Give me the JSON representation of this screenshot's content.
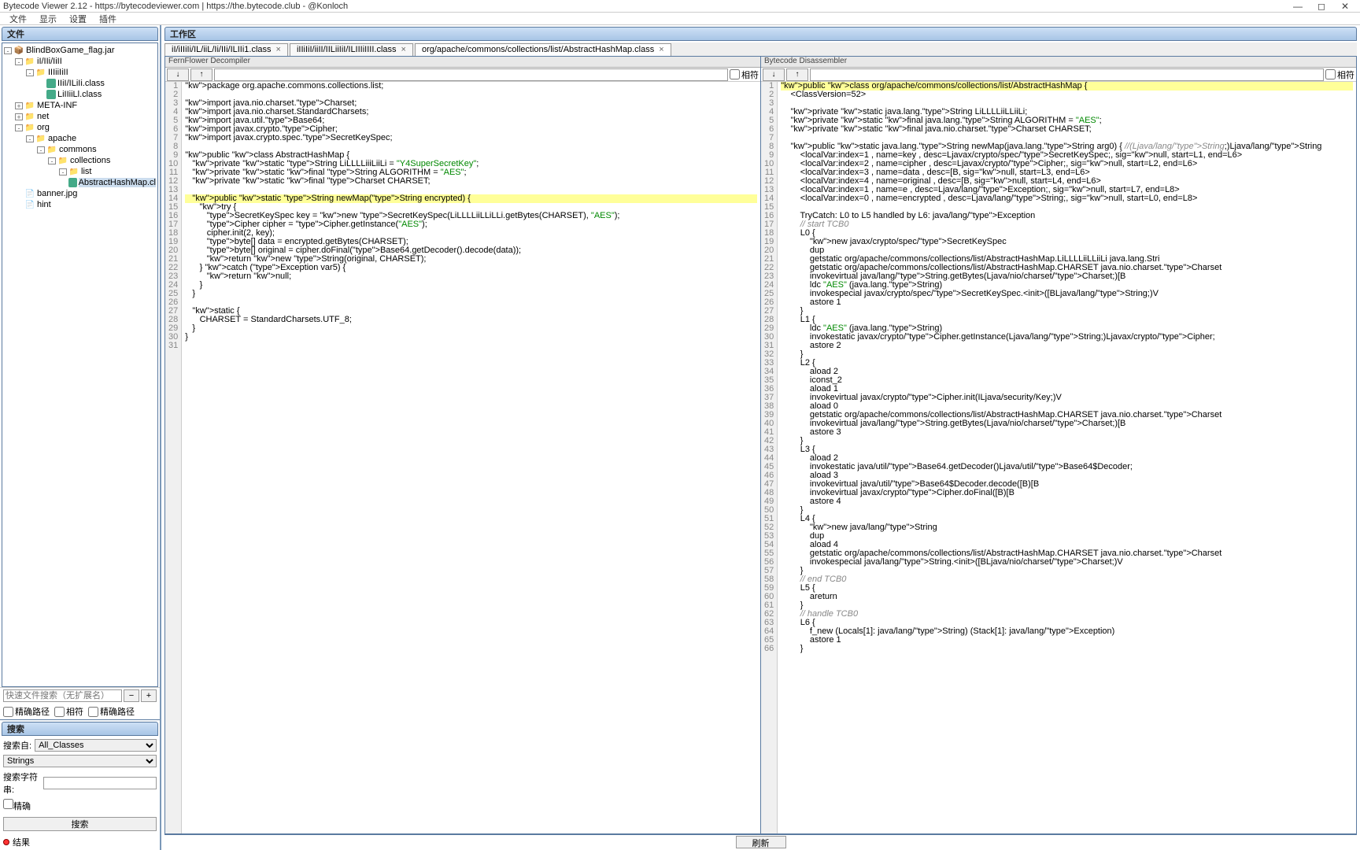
{
  "window": {
    "title": "Bytecode Viewer 2.12 - https://bytecodeviewer.com | https://the.bytecode.club - @Konloch"
  },
  "menu": {
    "file": "文件",
    "view": "显示",
    "settings": "设置",
    "plugins": "插件"
  },
  "left": {
    "files_header": "文件",
    "tree": [
      {
        "indent": 0,
        "toggle": "-",
        "icon": "jar",
        "label": "BlindBoxGame_flag.jar"
      },
      {
        "indent": 1,
        "toggle": "-",
        "icon": "folder",
        "label": "iI/IIi/IiII"
      },
      {
        "indent": 2,
        "toggle": "-",
        "icon": "folder",
        "label": "IIIiiIiII"
      },
      {
        "indent": 3,
        "toggle": "",
        "icon": "class",
        "label": "IIiI/ILiIi.class"
      },
      {
        "indent": 3,
        "toggle": "",
        "icon": "class",
        "label": "LiIIiiLl.class"
      },
      {
        "indent": 1,
        "toggle": "+",
        "icon": "folder",
        "label": "META-INF"
      },
      {
        "indent": 1,
        "toggle": "+",
        "icon": "folder",
        "label": "net"
      },
      {
        "indent": 1,
        "toggle": "-",
        "icon": "folder",
        "label": "org"
      },
      {
        "indent": 2,
        "toggle": "-",
        "icon": "folder",
        "label": "apache"
      },
      {
        "indent": 3,
        "toggle": "-",
        "icon": "folder",
        "label": "commons"
      },
      {
        "indent": 4,
        "toggle": "-",
        "icon": "folder",
        "label": "collections"
      },
      {
        "indent": 5,
        "toggle": "-",
        "icon": "folder",
        "label": "list"
      },
      {
        "indent": 6,
        "toggle": "",
        "icon": "class",
        "label": "AbstractHashMap.cl",
        "selected": true
      },
      {
        "indent": 1,
        "toggle": "",
        "icon": "file",
        "label": "banner.jpg"
      },
      {
        "indent": 1,
        "toggle": "",
        "icon": "file",
        "label": "hint"
      }
    ],
    "filter_placeholder": "快速文件搜索（无扩展名）",
    "minus": "−",
    "plus": "+",
    "chk_exact": "精确路径",
    "chk_matchcase": "相符",
    "chk_path": "精确路径",
    "search_header": "搜索",
    "search_from_label": "搜索自:",
    "search_from_value": "All_Classes",
    "strings_label": "Strings",
    "search_str_label": "搜索字符串:",
    "chk_exact2": "精确",
    "search_btn": "搜索",
    "results_label": "结果"
  },
  "workspace": {
    "header": "工作区",
    "tabs": [
      {
        "label": "iI/iIIiIi/IL/iiL/Ii/IIi/ILIIi1.class",
        "active": false
      },
      {
        "label": "iIIiIiI/iiII/IILiiIiI/ILIIIiIIII.class",
        "active": false
      },
      {
        "label": "org/apache/commons/collections/list/AbstractHashMap.class",
        "active": true
      }
    ],
    "left_panel_title": "FernFlower Decompiler",
    "right_panel_title": "Bytecode Disassembler",
    "toolbar": {
      "down": "↓",
      "up": "↑",
      "exact_chk": "相符"
    },
    "footer_btn": "刷新"
  },
  "decompiled": [
    {
      "n": 1,
      "t": "package org.apache.commons.collections.list;",
      "cls": ""
    },
    {
      "n": 2,
      "t": "",
      "cls": ""
    },
    {
      "n": 3,
      "t": "import java.nio.charset.Charset;",
      "cls": ""
    },
    {
      "n": 4,
      "t": "import java.nio.charset.StandardCharsets;",
      "cls": ""
    },
    {
      "n": 5,
      "t": "import java.util.Base64;",
      "cls": ""
    },
    {
      "n": 6,
      "t": "import javax.crypto.Cipher;",
      "cls": ""
    },
    {
      "n": 7,
      "t": "import javax.crypto.spec.SecretKeySpec;",
      "cls": ""
    },
    {
      "n": 8,
      "t": "",
      "cls": ""
    },
    {
      "n": 9,
      "t": "public class AbstractHashMap {",
      "cls": ""
    },
    {
      "n": 10,
      "t": "   private static String LiLLLLiiiLiiLi = \"Y4SuperSecretKey\";",
      "cls": ""
    },
    {
      "n": 11,
      "t": "   private static final String ALGORITHM = \"AES\";",
      "cls": ""
    },
    {
      "n": 12,
      "t": "   private static final Charset CHARSET;",
      "cls": ""
    },
    {
      "n": 13,
      "t": "",
      "cls": ""
    },
    {
      "n": 14,
      "t": "   public static String newMap(String encrypted) {",
      "cls": "hl"
    },
    {
      "n": 15,
      "t": "      try {",
      "cls": ""
    },
    {
      "n": 16,
      "t": "         SecretKeySpec key = new SecretKeySpec(LiLLLLiiLLiLLi.getBytes(CHARSET), \"AES\");",
      "cls": ""
    },
    {
      "n": 17,
      "t": "         Cipher cipher = Cipher.getInstance(\"AES\");",
      "cls": ""
    },
    {
      "n": 18,
      "t": "         cipher.init(2, key);",
      "cls": ""
    },
    {
      "n": 19,
      "t": "         byte[] data = encrypted.getBytes(CHARSET);",
      "cls": ""
    },
    {
      "n": 20,
      "t": "         byte[] original = cipher.doFinal(Base64.getDecoder().decode(data));",
      "cls": ""
    },
    {
      "n": 21,
      "t": "         return new String(original, CHARSET);",
      "cls": ""
    },
    {
      "n": 22,
      "t": "      } catch (Exception var5) {",
      "cls": ""
    },
    {
      "n": 23,
      "t": "         return null;",
      "cls": ""
    },
    {
      "n": 24,
      "t": "      }",
      "cls": ""
    },
    {
      "n": 25,
      "t": "   }",
      "cls": ""
    },
    {
      "n": 26,
      "t": "",
      "cls": ""
    },
    {
      "n": 27,
      "t": "   static {",
      "cls": ""
    },
    {
      "n": 28,
      "t": "      CHARSET = StandardCharsets.UTF_8;",
      "cls": ""
    },
    {
      "n": 29,
      "t": "   }",
      "cls": ""
    },
    {
      "n": 30,
      "t": "}",
      "cls": ""
    },
    {
      "n": 31,
      "t": "",
      "cls": ""
    }
  ],
  "bytecode": [
    {
      "n": 1,
      "t": "public class org/apache/commons/collections/list/AbstractHashMap {",
      "cls": "hl"
    },
    {
      "n": 2,
      "t": "    <ClassVersion=52>",
      "cls": ""
    },
    {
      "n": 3,
      "t": "",
      "cls": ""
    },
    {
      "n": 4,
      "t": "    private static java.lang.String LiLLLLiiLLiiLi;",
      "cls": ""
    },
    {
      "n": 5,
      "t": "    private static final java.lang.String ALGORITHM = \"AES\";",
      "cls": ""
    },
    {
      "n": 6,
      "t": "    private static final java.nio.charset.Charset CHARSET;",
      "cls": ""
    },
    {
      "n": 7,
      "t": "",
      "cls": ""
    },
    {
      "n": 8,
      "t": "    public static java.lang.String newMap(java.lang.String arg0) { //(Ljava/lang/String;)Ljava/lang/String",
      "cls": ""
    },
    {
      "n": 9,
      "t": "        <localVar:index=1 , name=key , desc=Ljavax/crypto/spec/SecretKeySpec;, sig=null, start=L1, end=L6>",
      "cls": ""
    },
    {
      "n": 10,
      "t": "        <localVar:index=2 , name=cipher , desc=Ljavax/crypto/Cipher;, sig=null, start=L2, end=L6>",
      "cls": ""
    },
    {
      "n": 11,
      "t": "        <localVar:index=3 , name=data , desc=[B, sig=null, start=L3, end=L6>",
      "cls": ""
    },
    {
      "n": 12,
      "t": "        <localVar:index=4 , name=original , desc=[B, sig=null, start=L4, end=L6>",
      "cls": ""
    },
    {
      "n": 13,
      "t": "        <localVar:index=1 , name=e , desc=Ljava/lang/Exception;, sig=null, start=L7, end=L8>",
      "cls": ""
    },
    {
      "n": 14,
      "t": "        <localVar:index=0 , name=encrypted , desc=Ljava/lang/String;, sig=null, start=L0, end=L8>",
      "cls": ""
    },
    {
      "n": 15,
      "t": "",
      "cls": ""
    },
    {
      "n": 16,
      "t": "        TryCatch: L0 to L5 handled by L6: java/lang/Exception",
      "cls": ""
    },
    {
      "n": 17,
      "t": "        // start TCB0",
      "cls": "cmt"
    },
    {
      "n": 18,
      "t": "        L0 {",
      "cls": ""
    },
    {
      "n": 19,
      "t": "            new javax/crypto/spec/SecretKeySpec",
      "cls": ""
    },
    {
      "n": 20,
      "t": "            dup",
      "cls": ""
    },
    {
      "n": 21,
      "t": "            getstatic org/apache/commons/collections/list/AbstractHashMap.LiLLLLiiLLiiLi java.lang.Stri",
      "cls": ""
    },
    {
      "n": 22,
      "t": "            getstatic org/apache/commons/collections/list/AbstractHashMap.CHARSET java.nio.charset.Charset",
      "cls": ""
    },
    {
      "n": 23,
      "t": "            invokevirtual java/lang/String.getBytes(Ljava/nio/charset/Charset;)[B",
      "cls": ""
    },
    {
      "n": 24,
      "t": "            ldc \"AES\" (java.lang.String)",
      "cls": ""
    },
    {
      "n": 25,
      "t": "            invokespecial javax/crypto/spec/SecretKeySpec.<init>([BLjava/lang/String;)V",
      "cls": ""
    },
    {
      "n": 26,
      "t": "            astore 1",
      "cls": ""
    },
    {
      "n": 27,
      "t": "        }",
      "cls": ""
    },
    {
      "n": 28,
      "t": "        L1 {",
      "cls": ""
    },
    {
      "n": 29,
      "t": "            ldc \"AES\" (java.lang.String)",
      "cls": ""
    },
    {
      "n": 30,
      "t": "            invokestatic javax/crypto/Cipher.getInstance(Ljava/lang/String;)Ljavax/crypto/Cipher;",
      "cls": ""
    },
    {
      "n": 31,
      "t": "            astore 2",
      "cls": ""
    },
    {
      "n": 32,
      "t": "        }",
      "cls": ""
    },
    {
      "n": 33,
      "t": "        L2 {",
      "cls": ""
    },
    {
      "n": 34,
      "t": "            aload 2",
      "cls": ""
    },
    {
      "n": 35,
      "t": "            iconst_2",
      "cls": ""
    },
    {
      "n": 36,
      "t": "            aload 1",
      "cls": ""
    },
    {
      "n": 37,
      "t": "            invokevirtual javax/crypto/Cipher.init(ILjava/security/Key;)V",
      "cls": ""
    },
    {
      "n": 38,
      "t": "            aload 0",
      "cls": ""
    },
    {
      "n": 39,
      "t": "            getstatic org/apache/commons/collections/list/AbstractHashMap.CHARSET java.nio.charset.Charset",
      "cls": ""
    },
    {
      "n": 40,
      "t": "            invokevirtual java/lang/String.getBytes(Ljava/nio/charset/Charset;)[B",
      "cls": ""
    },
    {
      "n": 41,
      "t": "            astore 3",
      "cls": ""
    },
    {
      "n": 42,
      "t": "        }",
      "cls": ""
    },
    {
      "n": 43,
      "t": "        L3 {",
      "cls": ""
    },
    {
      "n": 44,
      "t": "            aload 2",
      "cls": ""
    },
    {
      "n": 45,
      "t": "            invokestatic java/util/Base64.getDecoder()Ljava/util/Base64$Decoder;",
      "cls": ""
    },
    {
      "n": 46,
      "t": "            aload 3",
      "cls": ""
    },
    {
      "n": 47,
      "t": "            invokevirtual java/util/Base64$Decoder.decode([B)[B",
      "cls": ""
    },
    {
      "n": 48,
      "t": "            invokevirtual javax/crypto/Cipher.doFinal([B)[B",
      "cls": ""
    },
    {
      "n": 49,
      "t": "            astore 4",
      "cls": ""
    },
    {
      "n": 50,
      "t": "        }",
      "cls": ""
    },
    {
      "n": 51,
      "t": "        L4 {",
      "cls": ""
    },
    {
      "n": 52,
      "t": "            new java/lang/String",
      "cls": ""
    },
    {
      "n": 53,
      "t": "            dup",
      "cls": ""
    },
    {
      "n": 54,
      "t": "            aload 4",
      "cls": ""
    },
    {
      "n": 55,
      "t": "            getstatic org/apache/commons/collections/list/AbstractHashMap.CHARSET java.nio.charset.Charset",
      "cls": ""
    },
    {
      "n": 56,
      "t": "            invokespecial java/lang/String.<init>([BLjava/nio/charset/Charset;)V",
      "cls": ""
    },
    {
      "n": 57,
      "t": "        }",
      "cls": ""
    },
    {
      "n": 58,
      "t": "        // end TCB0",
      "cls": "cmt"
    },
    {
      "n": 59,
      "t": "        L5 {",
      "cls": ""
    },
    {
      "n": 60,
      "t": "            areturn",
      "cls": ""
    },
    {
      "n": 61,
      "t": "        }",
      "cls": ""
    },
    {
      "n": 62,
      "t": "        // handle TCB0",
      "cls": "cmt"
    },
    {
      "n": 63,
      "t": "        L6 {",
      "cls": ""
    },
    {
      "n": 64,
      "t": "            f_new (Locals[1]: java/lang/String) (Stack[1]: java/lang/Exception)",
      "cls": ""
    },
    {
      "n": 65,
      "t": "            astore 1",
      "cls": ""
    },
    {
      "n": 66,
      "t": "        }",
      "cls": ""
    }
  ]
}
